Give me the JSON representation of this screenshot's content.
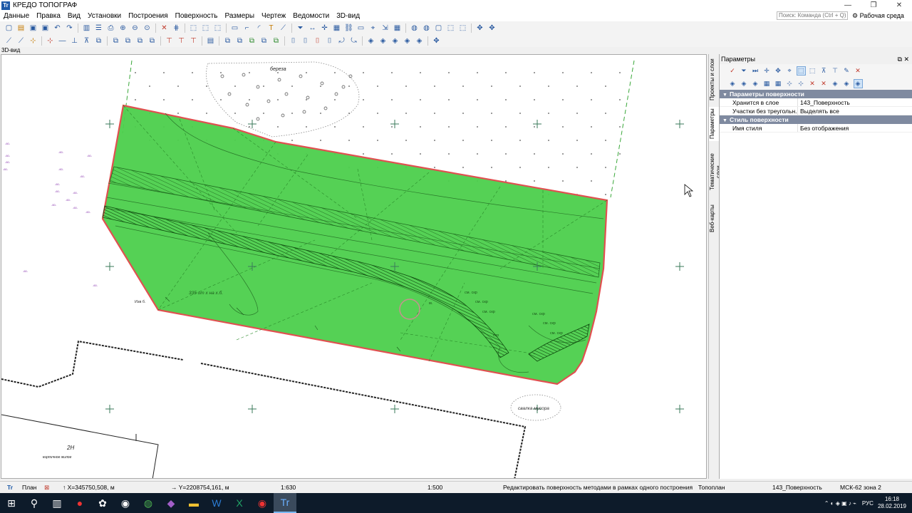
{
  "window": {
    "title": "КРЕДО ТОПОГРАФ",
    "search_placeholder": "Поиск: Команда (Ctrl + Q)",
    "workspace_label": "Рабочая среда",
    "controls": [
      "—",
      "❐",
      "✕"
    ]
  },
  "menu": [
    "Данные",
    "Правка",
    "Вид",
    "Установки",
    "Построения",
    "Поверхность",
    "Размеры",
    "Чертеж",
    "Ведомости",
    "3D-вид"
  ],
  "view_label": "3D-вид",
  "side_tabs": [
    "Проекты и слои",
    "Параметры",
    "Тематические слои",
    "Веб-карты"
  ],
  "params_panel": {
    "title": "Параметры",
    "sections": [
      {
        "title": "Параметры поверхности",
        "rows": [
          {
            "key": "Хранится в слое",
            "value": "143_Поверхность"
          },
          {
            "key": "Участки без треугольн...",
            "value": "Выделять все"
          }
        ]
      },
      {
        "title": "Стиль поверхности",
        "rows": [
          {
            "key": "Имя стиля",
            "value": "Без отображения"
          }
        ]
      }
    ]
  },
  "map_labels": {
    "birch": "береза",
    "dump": "свалка мусора",
    "building": "2Н",
    "building_sub": "кирпичное жилое",
    "annotation": "Изв б.",
    "dims": "335 от х на х.б."
  },
  "status": {
    "tab_plan": "План",
    "x": "↑ X=345750,508, м",
    "y": "→ Y=2208754,161, м",
    "scale1": "1:630",
    "scale2": "1:500",
    "hint": "Редактировать поверхность методами в рамках одного построения",
    "layer_topo": "Топоплан",
    "layer_surface": "143_Поверхность",
    "crs": "МСК-62 зона 2"
  },
  "taskbar": {
    "icons": [
      "windows-start",
      "search",
      "task-view",
      "record",
      "app",
      "chrome",
      "onenote",
      "explorer",
      "word",
      "excel",
      "recorder",
      "credo"
    ],
    "lang": "РУС",
    "time": "16:18",
    "date": "28.02.2019"
  },
  "colors": {
    "surface_fill": "#4ccf4c",
    "surface_border": "#e05050",
    "section_header": "#7f8aa0",
    "taskbar": "#0d1b2a"
  }
}
